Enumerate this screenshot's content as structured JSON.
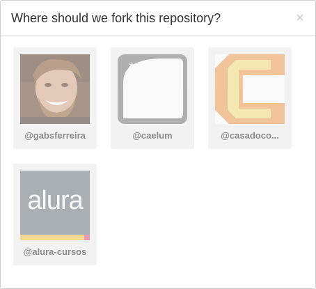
{
  "dialog": {
    "title": "Where should we fork this repository?",
    "close_label": "×"
  },
  "accounts": [
    {
      "login": "@gabsferreira",
      "avatar": "profile-photo"
    },
    {
      "login": "@caelum",
      "avatar": "caelum-logo"
    },
    {
      "login": "@casadoco...",
      "avatar": "casadocodigo-logo"
    },
    {
      "login": "@alura-cursos",
      "avatar": "alura-logo",
      "logo_text": "alura"
    }
  ],
  "colors": {
    "card_bg": "#f2f2f2",
    "login_text": "#8c8c8c",
    "title_text": "#333333",
    "caelum_gray": "#7a7a7a",
    "casadocodigo_orange": "#f0a050",
    "casadocodigo_yellow": "#f5e07a",
    "alura_gray": "#6f7a80",
    "alura_yellow": "#f5c842",
    "alura_pink": "#e8507a"
  }
}
